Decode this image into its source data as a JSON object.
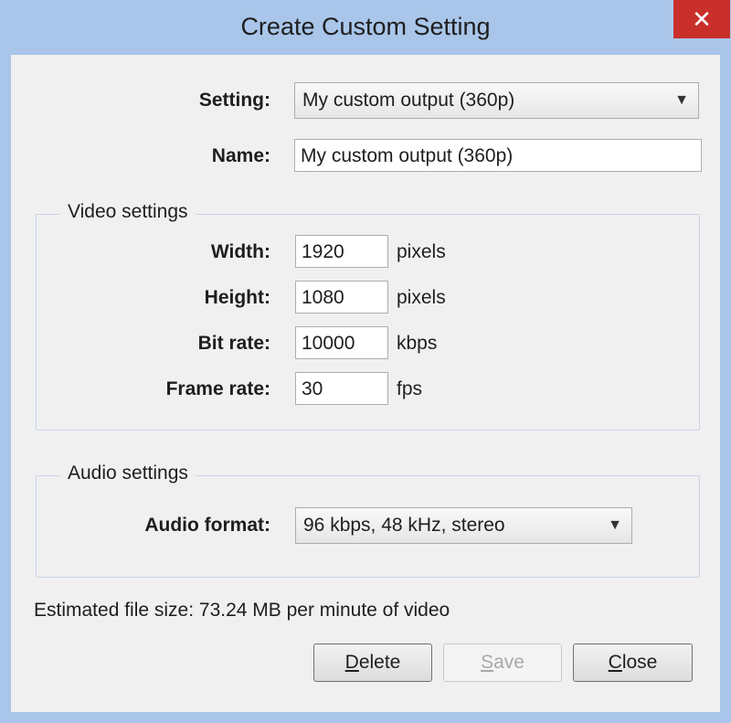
{
  "window": {
    "title": "Create Custom Setting",
    "close_glyph": "✕"
  },
  "setting": {
    "label": "Setting:",
    "value": "My custom output (360p)",
    "arrow_icon": "chevron-down-icon"
  },
  "name": {
    "label": "Name:",
    "value": "My custom output (360p)"
  },
  "video": {
    "group_title": "Video settings",
    "width": {
      "label": "Width:",
      "value": "1920",
      "unit": "pixels"
    },
    "height": {
      "label": "Height:",
      "value": "1080",
      "unit": "pixels"
    },
    "bitrate": {
      "label": "Bit rate:",
      "value": "10000",
      "unit": "kbps"
    },
    "framerate": {
      "label": "Frame rate:",
      "value": "30",
      "unit": "fps"
    }
  },
  "audio": {
    "group_title": "Audio settings",
    "format_label": "Audio format:",
    "format_value": "96 kbps, 48 kHz, stereo"
  },
  "estimate_text": "Estimated file size: 73.24 MB per minute of video",
  "buttons": {
    "delete": {
      "mnemonic": "D",
      "rest": "elete",
      "enabled": true
    },
    "save": {
      "mnemonic": "S",
      "rest": "ave",
      "enabled": false
    },
    "close": {
      "mnemonic": "C",
      "rest": "lose",
      "enabled": true
    }
  },
  "colors": {
    "frame": "#a9c6ea",
    "close_button": "#c9302c",
    "client": "#f0f0f0"
  }
}
